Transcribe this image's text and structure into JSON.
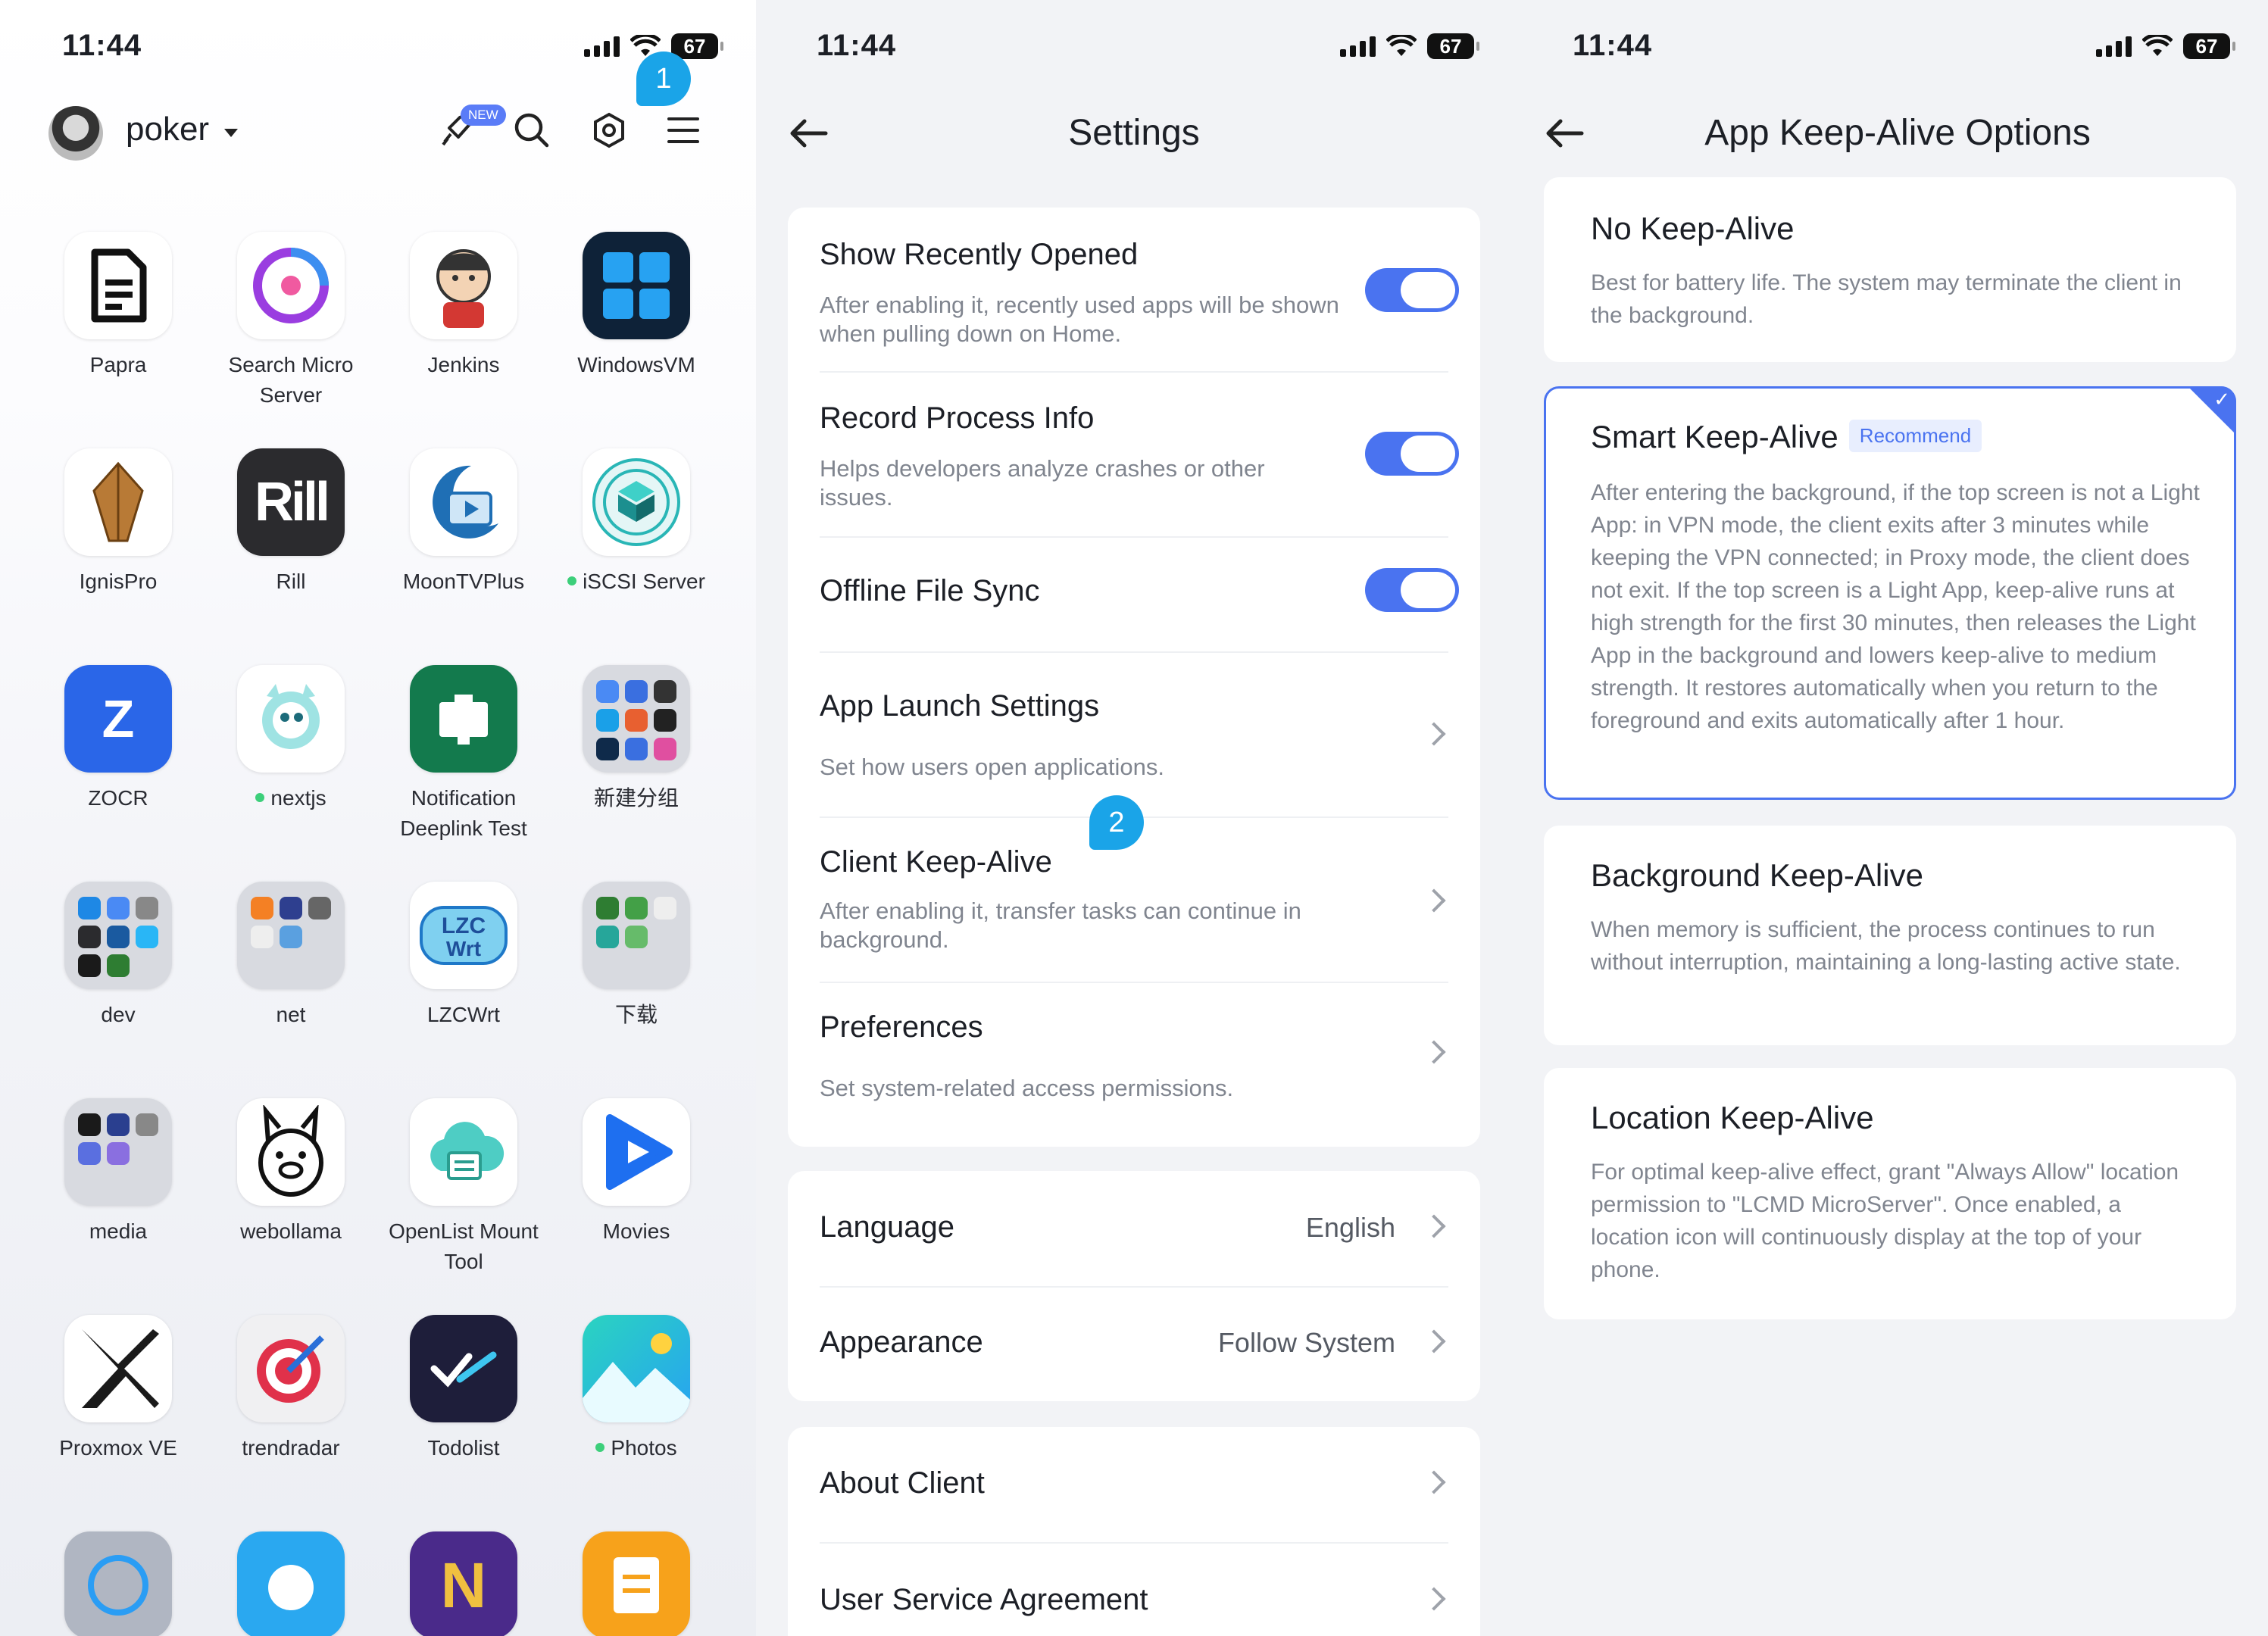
{
  "status": {
    "time": "11:44",
    "battery": "67"
  },
  "launcher": {
    "user": "poker",
    "new_badge": "NEW",
    "bubble_1": "1",
    "apps": [
      {
        "label": "Papra",
        "online": false
      },
      {
        "label": "Search Micro Server",
        "online": false
      },
      {
        "label": "Jenkins",
        "online": false
      },
      {
        "label": "WindowsVM",
        "online": false
      },
      {
        "label": "IgnisPro",
        "online": false
      },
      {
        "label": "Rill",
        "online": false
      },
      {
        "label": "MoonTVPlus",
        "online": false
      },
      {
        "label": "iSCSI Server",
        "online": true
      },
      {
        "label": "ZOCR",
        "online": false
      },
      {
        "label": "nextjs",
        "online": true
      },
      {
        "label": "Notification Deeplink Test",
        "online": false
      },
      {
        "label": "新建分组",
        "online": false
      },
      {
        "label": "dev",
        "online": false
      },
      {
        "label": "net",
        "online": false
      },
      {
        "label": "LZCWrt",
        "online": false
      },
      {
        "label": "下载",
        "online": false
      },
      {
        "label": "media",
        "online": false
      },
      {
        "label": "webollama",
        "online": false
      },
      {
        "label": "OpenList Mount Tool",
        "online": false
      },
      {
        "label": "Movies",
        "online": false
      },
      {
        "label": "Proxmox VE",
        "online": false
      },
      {
        "label": "trendradar",
        "online": false
      },
      {
        "label": "Todolist",
        "online": false
      },
      {
        "label": "Photos",
        "online": true
      }
    ]
  },
  "settings": {
    "title": "Settings",
    "bubble_2": "2",
    "items": [
      {
        "title": "Show Recently Opened",
        "desc": "After enabling it, recently used apps will be shown when pulling down on Home.",
        "toggle": true
      },
      {
        "title": "Record Process Info",
        "desc": "Helps developers analyze crashes or other issues.",
        "toggle": true
      },
      {
        "title": "Offline File Sync",
        "desc": "",
        "toggle": true
      },
      {
        "title": "App Launch Settings",
        "desc": "Set how users open applications."
      },
      {
        "title": "Client Keep-Alive",
        "desc": "After enabling it, transfer tasks can continue in background."
      },
      {
        "title": "Preferences",
        "desc": "Set system-related access permissions."
      }
    ],
    "language": {
      "label": "Language",
      "value": "English"
    },
    "appearance": {
      "label": "Appearance",
      "value": "Follow System"
    },
    "about": "About Client",
    "agreement": "User Service Agreement"
  },
  "keepalive": {
    "title": "App Keep-Alive Options",
    "options": [
      {
        "title": "No Keep-Alive",
        "desc": "Best for battery life. The system may terminate the client in the background."
      },
      {
        "title": "Smart Keep-Alive",
        "badge": "Recommend",
        "selected": true,
        "desc": "After entering the background, if the top screen is not a Light App: in VPN mode, the client exits after 3 minutes while keeping the VPN connected; in Proxy mode, the client does not exit. If the top screen is a Light App, keep-alive runs at high strength for the first 30 minutes, then releases the Light App in the background and lowers keep-alive to medium strength. It restores automatically when you return to the foreground and exits automatically after 1 hour."
      },
      {
        "title": "Background Keep-Alive",
        "desc": "When memory is sufficient, the process continues to run without interruption, maintaining a long-lasting active state."
      },
      {
        "title": "Location Keep-Alive",
        "desc": "For optimal keep-alive effect, grant \"Always Allow\" location permission to \"LCMD MicroServer\". Once enabled, a location icon will continuously display at the top of your phone."
      }
    ]
  },
  "colors": {
    "accent": "#4a73f0",
    "bubble": "#1aa4e8",
    "online": "#3ccf7a"
  }
}
